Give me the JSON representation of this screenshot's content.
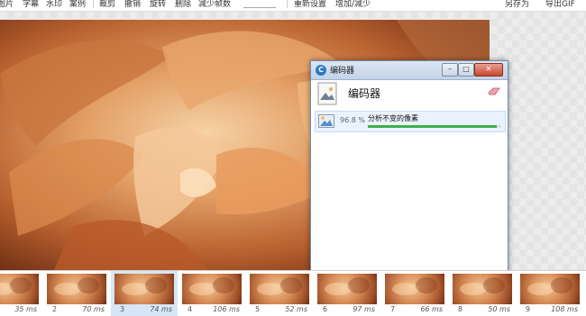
{
  "toolbar": {
    "items": [
      "图片",
      "字幕",
      "水印",
      "案例",
      "裁剪",
      "撤销",
      "旋转",
      "删除",
      "减少帧数",
      "重新设置",
      "增加/减少",
      "另存为",
      "导出GIF"
    ]
  },
  "dialog": {
    "title": "编码器",
    "header_title": "编码器",
    "task": {
      "percent": "96.8 %",
      "label": "分析不变的像素",
      "progress": 0.968
    },
    "colors": {
      "progress": "#3fae4c",
      "accent": "#2c79c4"
    }
  },
  "frames": [
    {
      "number": "",
      "delay": "35 ms"
    },
    {
      "number": "2",
      "delay": "70 ms"
    },
    {
      "number": "3",
      "delay": "74 ms"
    },
    {
      "number": "4",
      "delay": "106 ms"
    },
    {
      "number": "5",
      "delay": "52 ms"
    },
    {
      "number": "6",
      "delay": "97 ms"
    },
    {
      "number": "7",
      "delay": "66 ms"
    },
    {
      "number": "8",
      "delay": "50 ms"
    },
    {
      "number": "9",
      "delay": "108 ms"
    }
  ],
  "selected_frame_index": 2
}
